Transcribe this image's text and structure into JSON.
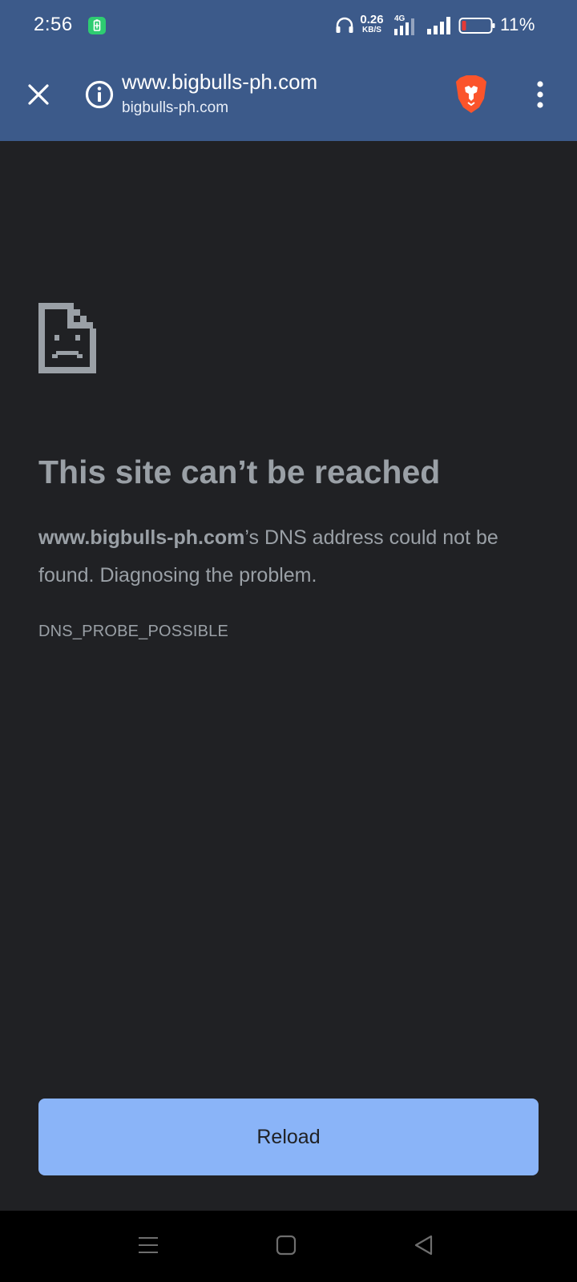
{
  "status_bar": {
    "time": "2:56",
    "net_speed_value": "0.26",
    "net_speed_unit": "KB/S",
    "network_type": "4G",
    "battery_percent": "11%",
    "battery_level": 0.11,
    "icons": [
      "battery-saver-icon",
      "headphones-icon",
      "signal-4g-icon",
      "signal-icon",
      "battery-icon"
    ]
  },
  "toolbar": {
    "url_title": "www.bigbulls-ph.com",
    "url_subtitle": "bigbulls-ph.com",
    "icons": [
      "close-icon",
      "info-icon",
      "brave-lion-icon",
      "more-vert-icon"
    ]
  },
  "error": {
    "heading": "This site can’t be reached",
    "host": "www.bigbulls-ph.com",
    "message_rest": "’s DNS address could not be found. Diagnosing the problem.",
    "code": "DNS_PROBE_POSSIBLE",
    "icon": "sad-page-icon"
  },
  "actions": {
    "reload_label": "Reload"
  },
  "nav_bar": {
    "icons": [
      "recents-icon",
      "home-icon",
      "back-icon"
    ]
  },
  "colors": {
    "toolbar_bg": "#3c5a8a",
    "page_bg": "#202124",
    "text_muted": "#9aa0a6",
    "reload_bg": "#8ab4f8",
    "brave_orange": "#fb542b",
    "battery_low": "#e53935",
    "battery_saver_green": "#2ecc71"
  }
}
